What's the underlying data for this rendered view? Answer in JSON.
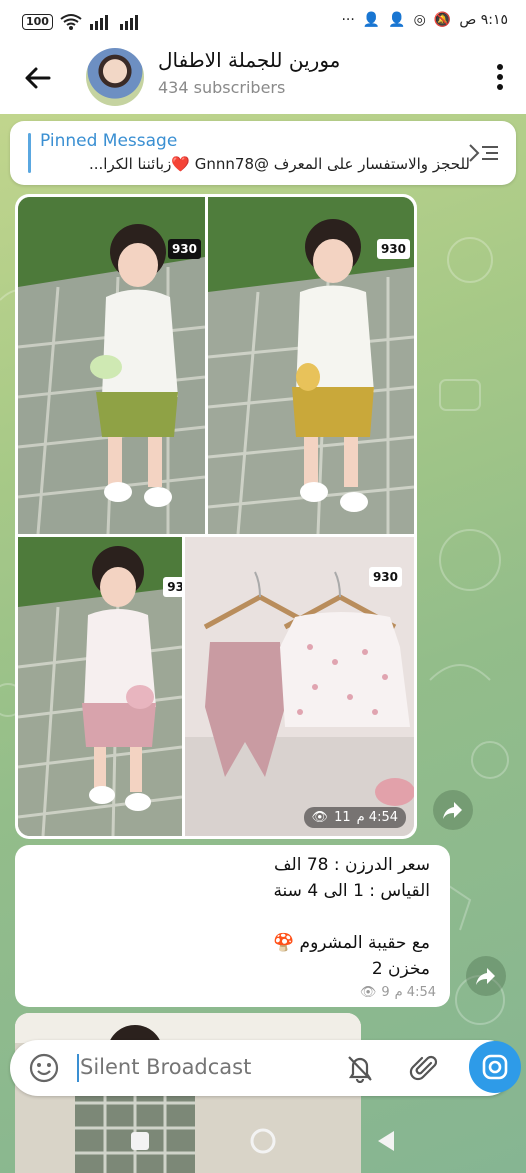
{
  "status_bar": {
    "battery": "100",
    "time": "٩:١٥ ص",
    "more": "···"
  },
  "header": {
    "channel_name": "مورين للجملة الاطفال",
    "subscribers": "434 subscribers"
  },
  "pinned": {
    "title": "Pinned Message",
    "text": "للحجز والاستفسار على المعرف @Gnnn78 ❤️زبائننا الكرا..."
  },
  "album": {
    "tags": [
      "930",
      "930",
      "93",
      "930"
    ],
    "views": "11",
    "time": "4:54 م"
  },
  "message": {
    "lines": [
      "سعر الدرزن : 78 الف",
      "القياس : 1 الى 4 سنة",
      "",
      "مع حقيبة المشروم 🍄",
      "مخزن 2"
    ],
    "views": "9",
    "time": "4:54 م"
  },
  "composer": {
    "placeholder": "Silent Broadcast"
  },
  "colors": {
    "accent": "#2e9be8",
    "pinned_title": "#3a8fd2"
  }
}
